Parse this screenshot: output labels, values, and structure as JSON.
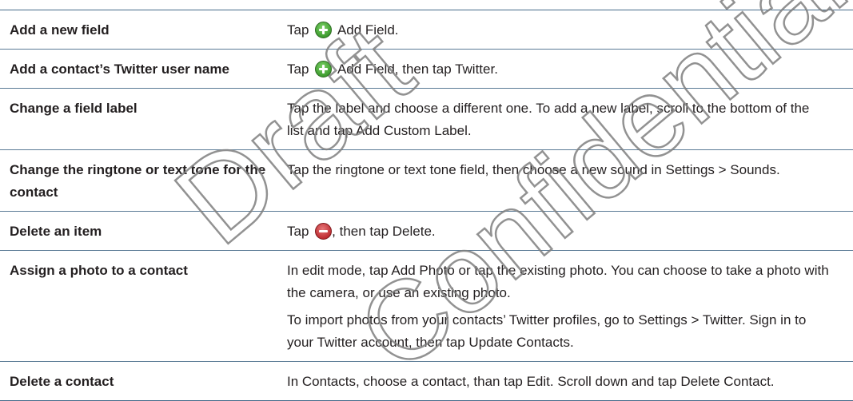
{
  "watermark": {
    "word1": "Draft",
    "word2": "Confidential",
    "color": "#7f7f7f"
  },
  "colors": {
    "rule": "#466b8a",
    "add_icon": "#3e9c2f",
    "delete_icon": "#bf2e33"
  },
  "rows": [
    {
      "task": "Add a new field",
      "action_pre": "Tap",
      "icon": "add-icon",
      "action_post": "Add Field."
    },
    {
      "task": "Add a contact’s Twitter user name",
      "action_pre": "Tap",
      "icon": "add-icon",
      "action_post": "Add Field, then tap Twitter."
    },
    {
      "task": "Change a field label",
      "action": "Tap the label and choose a different one. To add a new label, scroll to the bottom of the list and tap Add Custom Label."
    },
    {
      "task": "Change the ringtone or text tone for the contact",
      "action": "Tap the ringtone or text tone field, then choose a new sound in Settings > Sounds."
    },
    {
      "task": "Delete an item",
      "action_pre": "Tap",
      "icon": "delete-icon",
      "action_post": ", then tap Delete."
    },
    {
      "task": "Assign a photo to a contact",
      "action": "In edit mode, tap Add Photo or tap the existing photo. You can choose to take a photo with the camera, or use an existing photo.",
      "action2": "To import photos from your contacts’ Twitter profiles, go to Settings > Twitter. Sign in to your Twitter account, then tap Update Contacts."
    },
    {
      "task": "Delete a contact",
      "action": "In Contacts, choose a contact, than tap Edit. Scroll down and tap Delete Contact."
    }
  ]
}
